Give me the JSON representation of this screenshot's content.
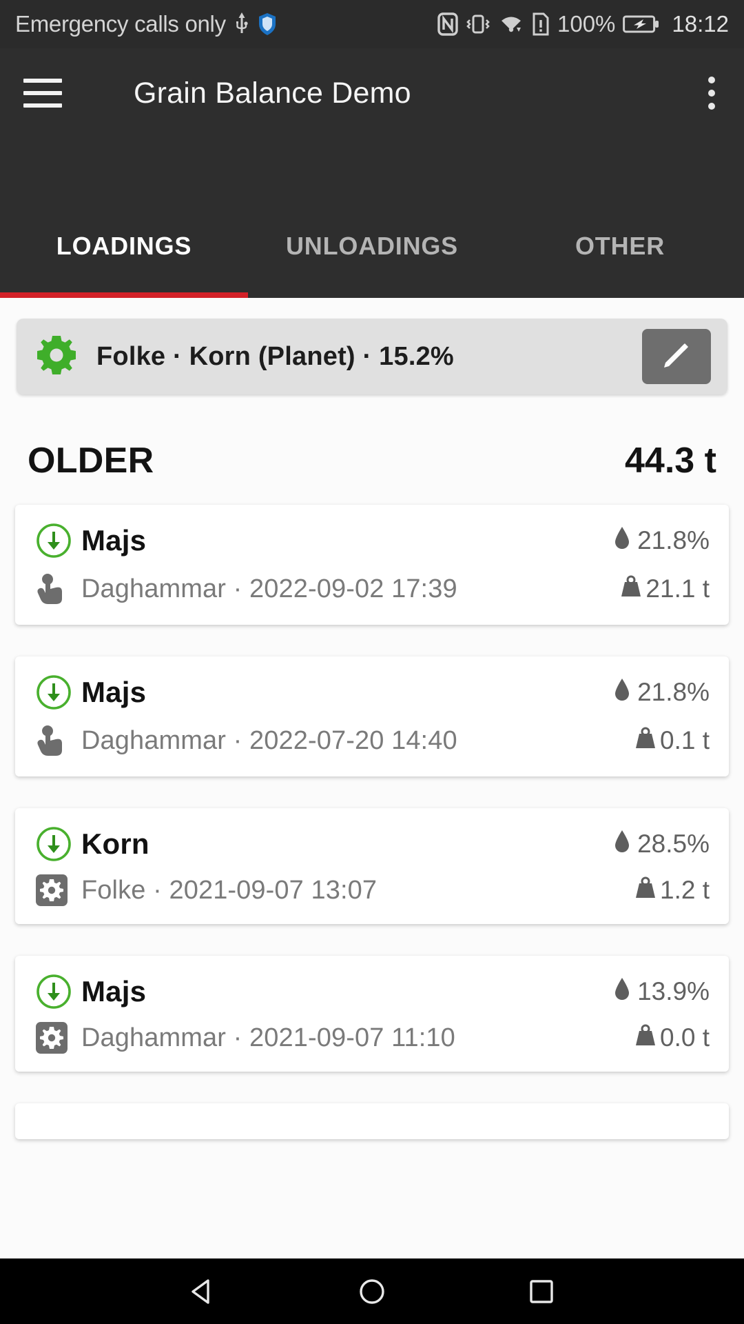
{
  "status_bar": {
    "carrier_text": "Emergency calls only",
    "icons": [
      "usb-icon",
      "shield-icon",
      "nfc-icon",
      "vibrate-icon",
      "wifi-icon",
      "sim-alert-icon"
    ],
    "battery_percent": "100%",
    "battery_state": "charging",
    "time": "18:12"
  },
  "app_bar": {
    "menu_icon": "hamburger-menu-icon",
    "title": "Grain Balance Demo",
    "overflow_icon": "more-vertical-icon"
  },
  "tabs": {
    "items": [
      {
        "label": "LOADINGS",
        "active": true
      },
      {
        "label": "UNLOADINGS",
        "active": false
      },
      {
        "label": "OTHER",
        "active": false
      }
    ],
    "indicator_color": "#d32128"
  },
  "filter": {
    "icon": "gear-icon",
    "icon_color": "#3fae2a",
    "text": "Folke · Korn (Planet) · 15.2%",
    "edit_button_icon": "pencil-icon",
    "edit_button_color": "#6e6e6e"
  },
  "section": {
    "title": "OLDER",
    "total": "44.3 t"
  },
  "entries": [
    {
      "direction_icon": "arrow-down-circle-icon",
      "crop": "Majs",
      "source_icon": "hand-touch-icon",
      "subtitle": "Daghammar · 2022-09-02 17:39",
      "moisture_icon": "water-drop-icon",
      "moisture": "21.8%",
      "weight_icon": "weight-icon",
      "weight": "21.1 t"
    },
    {
      "direction_icon": "arrow-down-circle-icon",
      "crop": "Majs",
      "source_icon": "hand-touch-icon",
      "subtitle": "Daghammar · 2022-07-20 14:40",
      "moisture_icon": "water-drop-icon",
      "moisture": "21.8%",
      "weight_icon": "weight-icon",
      "weight": "0.1 t"
    },
    {
      "direction_icon": "arrow-down-circle-icon",
      "crop": "Korn",
      "source_icon": "gear-square-icon",
      "subtitle": "Folke · 2021-09-07 13:07",
      "moisture_icon": "water-drop-icon",
      "moisture": "28.5%",
      "weight_icon": "weight-icon",
      "weight": "1.2 t"
    },
    {
      "direction_icon": "arrow-down-circle-icon",
      "crop": "Majs",
      "source_icon": "gear-square-icon",
      "subtitle": "Daghammar · 2021-09-07 11:10",
      "moisture_icon": "water-drop-icon",
      "moisture": "13.9%",
      "weight_icon": "weight-icon",
      "weight": "0.0 t"
    }
  ],
  "nav_bar": {
    "back_icon": "triangle-back-icon",
    "home_icon": "circle-home-icon",
    "recents_icon": "square-recents-icon"
  }
}
